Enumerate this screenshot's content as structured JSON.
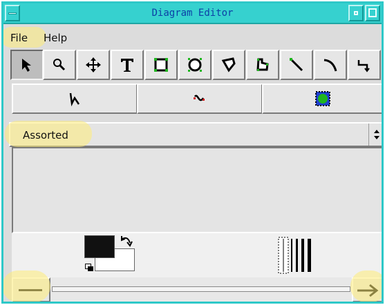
{
  "window": {
    "title": "Diagram Editor"
  },
  "menubar": {
    "file": "File",
    "help": "Help"
  },
  "toolbar": {
    "tools": [
      {
        "name": "select-arrow-icon",
        "active": true
      },
      {
        "name": "zoom-magnifier-icon"
      },
      {
        "name": "move-cross-arrows-icon"
      },
      {
        "name": "text-tool-icon",
        "glyph": "T"
      },
      {
        "name": "rectangle-tool-icon"
      },
      {
        "name": "ellipse-tool-icon"
      },
      {
        "name": "polygon-tool-icon"
      },
      {
        "name": "closed-curve-tool-icon"
      },
      {
        "name": "line-tool-icon"
      },
      {
        "name": "arc-tool-icon"
      },
      {
        "name": "zigzag-line-tool-icon"
      }
    ]
  },
  "toolbar2": {
    "tools": [
      {
        "name": "polyline-tool-icon"
      },
      {
        "name": "bezier-tool-icon"
      },
      {
        "name": "image-tool-icon"
      }
    ]
  },
  "sheet_selector": {
    "value": "Assorted"
  },
  "colors": {
    "titlebar": "#36d1cf",
    "title_text": "#0c3fa6",
    "highlight": "#ffec78",
    "image_icon_green": "#1fb51f",
    "image_icon_blue": "#1f3fd0"
  }
}
